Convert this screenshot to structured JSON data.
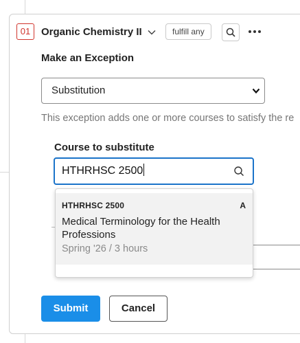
{
  "requirement": {
    "number": "01",
    "course_title": "Organic Chemistry II",
    "fulfill_label": "fulfill any"
  },
  "exception": {
    "heading": "Make an Exception",
    "type_selected": "Substitution",
    "help_text": "This exception adds one or more courses to satisfy the re"
  },
  "substitute": {
    "label": "Course to substitute",
    "input_value": "HTHRHSC 2500"
  },
  "results": [
    {
      "code": "HTHRHSC 2500",
      "grade": "A",
      "name": "Medical Terminology for the Health Professions",
      "meta": "Spring '26 / 3 hours"
    }
  ],
  "actions": {
    "submit_label": "Submit",
    "cancel_label": "Cancel"
  },
  "colors": {
    "accent": "#1a8ee8",
    "focus_border": "#1a73c9",
    "requirement_number": "#d0342c"
  },
  "icons": {
    "expand": "chevron-down-icon",
    "search": "search-icon",
    "more": "more-horizontal-icon",
    "select": "chevron-down-icon"
  }
}
